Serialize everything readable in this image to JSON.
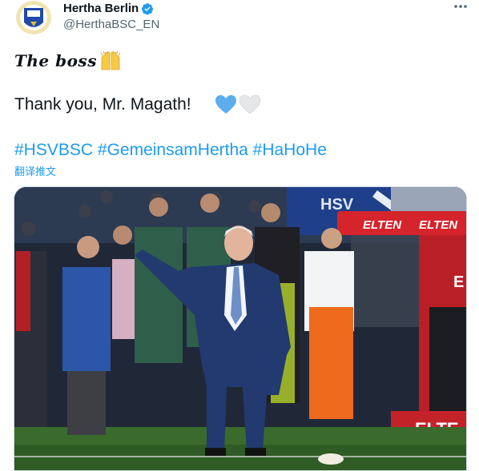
{
  "tweet": {
    "author": {
      "name": "Hertha Berlin",
      "handle": "@HerthaBSC_EN",
      "verified": true,
      "avatar_icon": "hertha-logo-icon"
    },
    "more_icon": "more-icon",
    "lines": {
      "line1": "The boss",
      "line1_emoji": "raising-hands-emoji",
      "line2": "Thank you, Mr. Magath!",
      "line2_emojis": [
        "blue-heart-emoji",
        "white-heart-emoji"
      ]
    },
    "hashtags": [
      "#HSVBSC",
      "#GemeinsamHertha",
      "#HaHoHe"
    ],
    "translate_label": "翻译推文",
    "media": {
      "type": "photo",
      "signage": [
        "ELTEN",
        "ELTEN",
        "HSV",
        "E",
        "ELTE"
      ]
    }
  },
  "colors": {
    "link": "#1d9bf0",
    "text": "#0f1419",
    "secondary": "#536471",
    "verified": "#1d9bf0"
  }
}
